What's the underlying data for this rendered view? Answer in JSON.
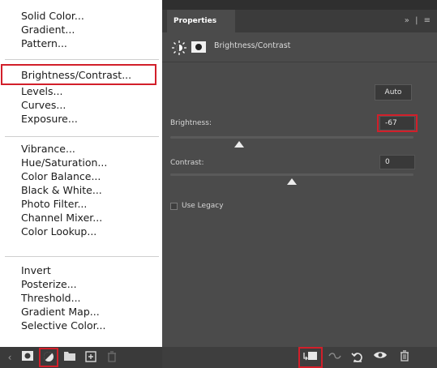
{
  "adjustment_menu": {
    "items": [
      "Solid Color...",
      "Gradient...",
      "Pattern...",
      "Brightness/Contrast...",
      "Levels...",
      "Curves...",
      "Exposure...",
      "Vibrance...",
      "Hue/Saturation...",
      "Color Balance...",
      "Black & White...",
      "Photo Filter...",
      "Channel Mixer...",
      "Color Lookup...",
      "Invert",
      "Posterize...",
      "Threshold...",
      "Gradient Map...",
      "Selective Color..."
    ],
    "highlighted_item": "Brightness/Contrast..."
  },
  "properties": {
    "tab_label": "Properties",
    "panel_controls": "» | ≡",
    "title": "Brightness/Contrast",
    "auto_label": "Auto",
    "brightness": {
      "label": "Brightness:",
      "value": "-67"
    },
    "contrast": {
      "label": "Contrast:",
      "value": "0"
    },
    "use_legacy": {
      "label": "Use Legacy",
      "checked": false
    }
  },
  "colors": {
    "panel_bg": "#4b4b4b",
    "highlight": "#d21f2a",
    "menu_bg": "#ffffff"
  }
}
